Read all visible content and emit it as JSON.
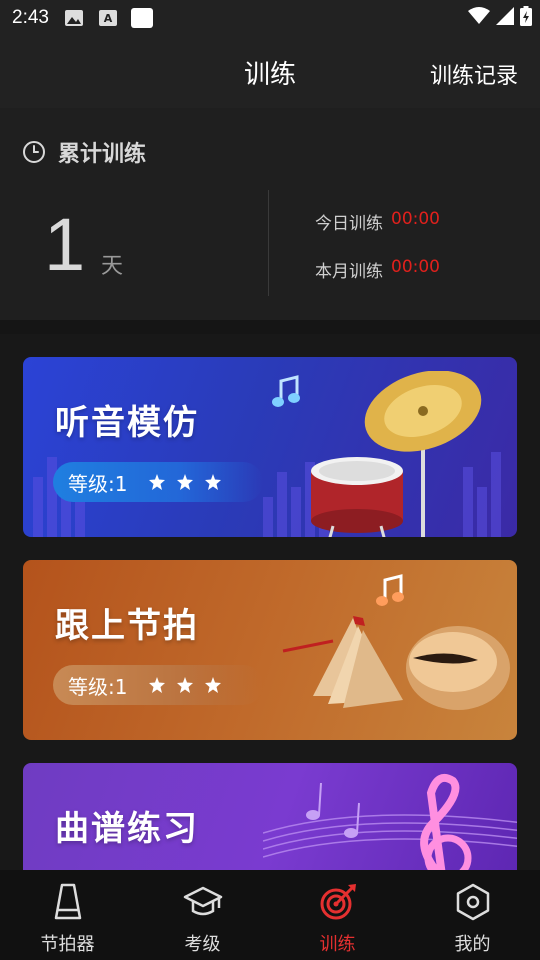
{
  "status_bar": {
    "time": "2:43"
  },
  "header": {
    "title": "训练",
    "record_label": "训练记录"
  },
  "summary": {
    "heading": "累计训练",
    "days_value": "1",
    "days_unit": "天",
    "today_label": "今日训练",
    "today_value": "00:00",
    "month_label": "本月训练",
    "month_value": "00:00"
  },
  "cards": [
    {
      "name": "听音模仿",
      "level": "等级:1",
      "stars": 3
    },
    {
      "name": "跟上节拍",
      "level": "等级:1",
      "stars": 3
    },
    {
      "name": "曲谱练习"
    }
  ],
  "nav": [
    {
      "label": "节拍器",
      "icon": "metronome-icon"
    },
    {
      "label": "考级",
      "icon": "graduation-cap-icon"
    },
    {
      "label": "训练",
      "icon": "target-icon",
      "active": true
    },
    {
      "label": "我的",
      "icon": "hexagon-profile-icon"
    }
  ],
  "colors": {
    "accent": "#e53030",
    "timer_value": "#e0201c"
  }
}
